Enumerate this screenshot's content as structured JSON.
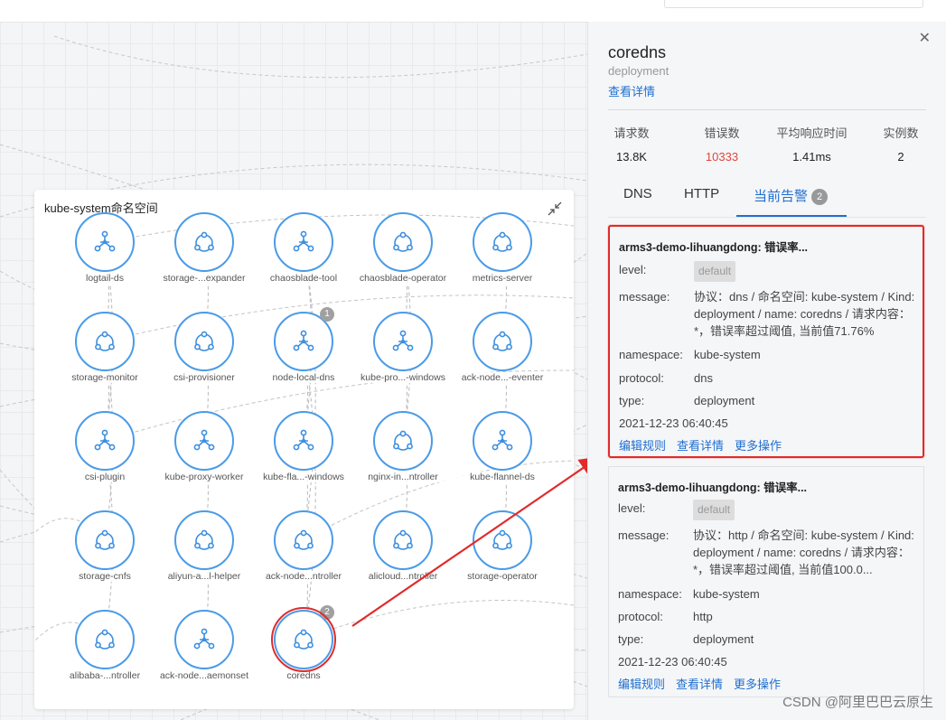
{
  "namespace_panel": {
    "title": "kube-system命名空间",
    "nodes": [
      {
        "label": "logtail-ds",
        "icon": "tri-nodes",
        "badge": ""
      },
      {
        "label": "storage-...expander",
        "icon": "circle-nodes",
        "badge": ""
      },
      {
        "label": "chaosblade-tool",
        "icon": "tri-nodes",
        "badge": ""
      },
      {
        "label": "chaosblade-operator",
        "icon": "circle-nodes",
        "badge": ""
      },
      {
        "label": "metrics-server",
        "icon": "circle-nodes",
        "badge": ""
      },
      {
        "label": "storage-monitor",
        "icon": "circle-nodes",
        "badge": ""
      },
      {
        "label": "csi-provisioner",
        "icon": "circle-nodes",
        "badge": ""
      },
      {
        "label": "node-local-dns",
        "icon": "tri-nodes",
        "badge": "1"
      },
      {
        "label": "kube-pro...-windows",
        "icon": "tri-nodes",
        "badge": ""
      },
      {
        "label": "ack-node...-eventer",
        "icon": "circle-nodes",
        "badge": ""
      },
      {
        "label": "csi-plugin",
        "icon": "tri-nodes",
        "badge": ""
      },
      {
        "label": "kube-proxy-worker",
        "icon": "tri-nodes",
        "badge": ""
      },
      {
        "label": "kube-fla...-windows",
        "icon": "tri-nodes",
        "badge": ""
      },
      {
        "label": "nginx-in...ntroller",
        "icon": "circle-nodes",
        "badge": ""
      },
      {
        "label": "kube-flannel-ds",
        "icon": "tri-nodes",
        "badge": ""
      },
      {
        "label": "storage-cnfs",
        "icon": "circle-nodes",
        "badge": ""
      },
      {
        "label": "aliyun-a...l-helper",
        "icon": "circle-nodes",
        "badge": ""
      },
      {
        "label": "ack-node...ntroller",
        "icon": "circle-nodes",
        "badge": ""
      },
      {
        "label": "alicloud...ntroller",
        "icon": "circle-nodes",
        "badge": ""
      },
      {
        "label": "storage-operator",
        "icon": "circle-nodes",
        "badge": ""
      },
      {
        "label": "alibaba-...ntroller",
        "icon": "circle-nodes",
        "badge": ""
      },
      {
        "label": "ack-node...aemonset",
        "icon": "tri-nodes",
        "badge": ""
      },
      {
        "label": "coredns",
        "icon": "circle-nodes",
        "badge": "2"
      }
    ]
  },
  "detail": {
    "name": "coredns",
    "type": "deployment",
    "view_details": "查看详情",
    "stats": [
      {
        "label": "请求数",
        "value": "13.8K",
        "color": "#222222"
      },
      {
        "label": "错误数",
        "value": "10333",
        "color": "#e0463a"
      },
      {
        "label": "平均响应时间",
        "value": "1.41ms",
        "color": "#222222"
      },
      {
        "label": "实例数",
        "value": "2",
        "color": "#222222"
      }
    ],
    "tabs": [
      {
        "label": "DNS"
      },
      {
        "label": "HTTP"
      },
      {
        "label": "当前告警",
        "badge": "2"
      }
    ],
    "alerts": [
      {
        "title": "arms3-demo-lihuangdong: 错误率...",
        "level_label": "level:",
        "level": "default",
        "message_label": "message:",
        "message": "协议：dns / 命名空间: kube-system / Kind: deployment / name: coredns / 请求内容：*，错误率超过阈值, 当前值71.76%",
        "namespace_label": "namespace:",
        "namespace": "kube-system",
        "protocol_label": "protocol:",
        "protocol": "dns",
        "type_label": "type:",
        "type": "deployment",
        "timestamp": "2021-12-23 06:40:45",
        "actions": [
          "编辑规则",
          "查看详情",
          "更多操作"
        ]
      },
      {
        "title": "arms3-demo-lihuangdong: 错误率...",
        "level_label": "level:",
        "level": "default",
        "message_label": "message:",
        "message": "协议：http / 命名空间: kube-system / Kind: deployment / name: coredns / 请求内容：*，错误率超过阈值, 当前值100.0...",
        "namespace_label": "namespace:",
        "namespace": "kube-system",
        "protocol_label": "protocol:",
        "protocol": "http",
        "type_label": "type:",
        "type": "deployment",
        "timestamp": "2021-12-23 06:40:45",
        "actions": [
          "编辑规则",
          "查看详情",
          "更多操作"
        ]
      }
    ]
  },
  "watermark": "CSDN @阿里巴巴云原生",
  "colors": {
    "accent": "#1f6fd0",
    "node_border": "#4a9be8",
    "highlight": "#e12b2b",
    "error": "#e0463a"
  }
}
